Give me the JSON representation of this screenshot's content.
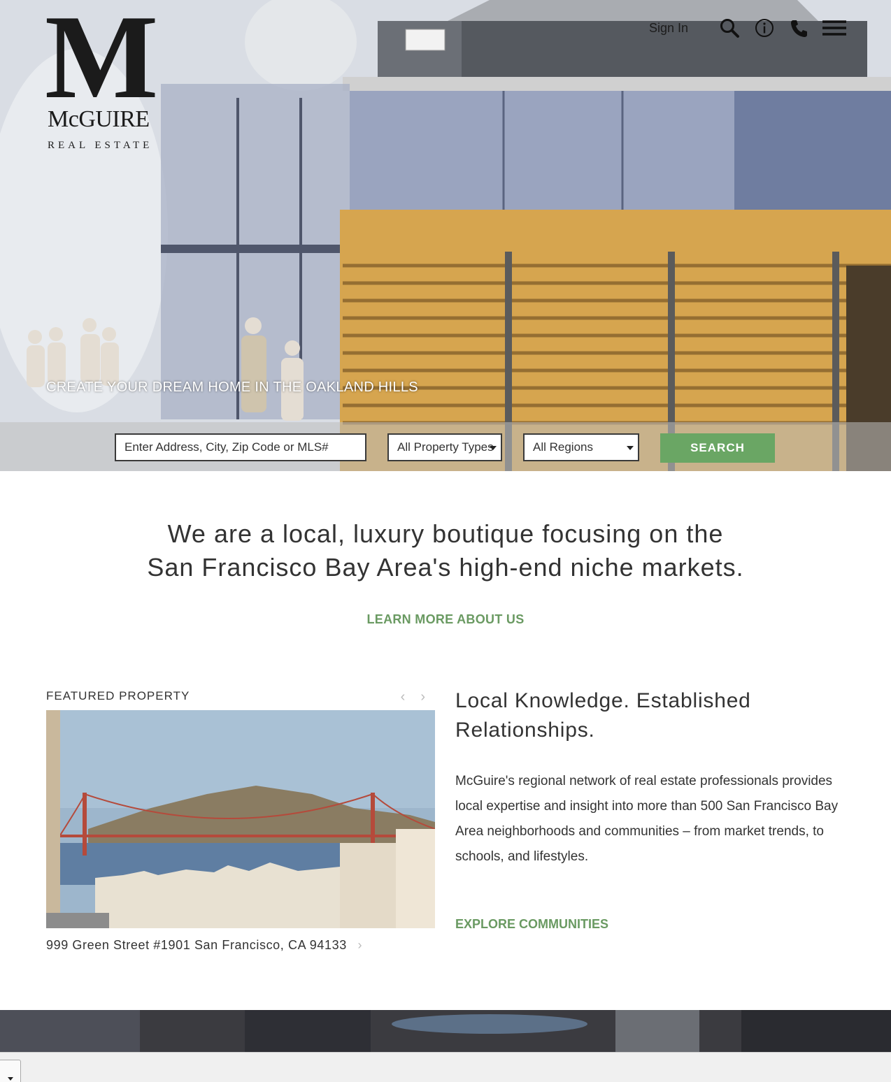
{
  "brand": {
    "logo_letter": "M",
    "logo_name": "McGUIRE",
    "logo_sub": "REAL ESTATE"
  },
  "nav": {
    "signin_label": "Sign In",
    "icons": [
      "search-icon",
      "info-icon",
      "phone-icon",
      "menu-icon"
    ]
  },
  "hero": {
    "tagline": "CREATE YOUR DREAM HOME IN THE OAKLAND HILLS"
  },
  "search": {
    "placeholder": "Enter Address, City, Zip Code or MLS#",
    "property_type": "All Property Types",
    "region": "All Regions",
    "button_label": "SEARCH"
  },
  "intro": {
    "line1": "We are a local, luxury boutique focusing on the",
    "line2": "San Francisco Bay Area's high-end niche markets.",
    "learn_more": "LEARN MORE ABOUT US"
  },
  "featured": {
    "label": "FEATURED PROPERTY",
    "prev": "‹",
    "next": "›",
    "address": "999 Green Street #1901 San Francisco, CA 94133",
    "chevron": "›"
  },
  "knowledge": {
    "title_line1": "Local Knowledge. Established",
    "title_line2": "Relationships.",
    "body": "McGuire's regional network of real estate professionals provides local expertise and insight into more than 500 San Francisco Bay Area neighborhoods and communities – from market trends, to schools, and lifestyles.",
    "explore": "EXPLORE COMMUNITIES"
  },
  "colors": {
    "accent_green": "#6aa664",
    "link_green": "#6a9a62",
    "text": "#333333"
  }
}
